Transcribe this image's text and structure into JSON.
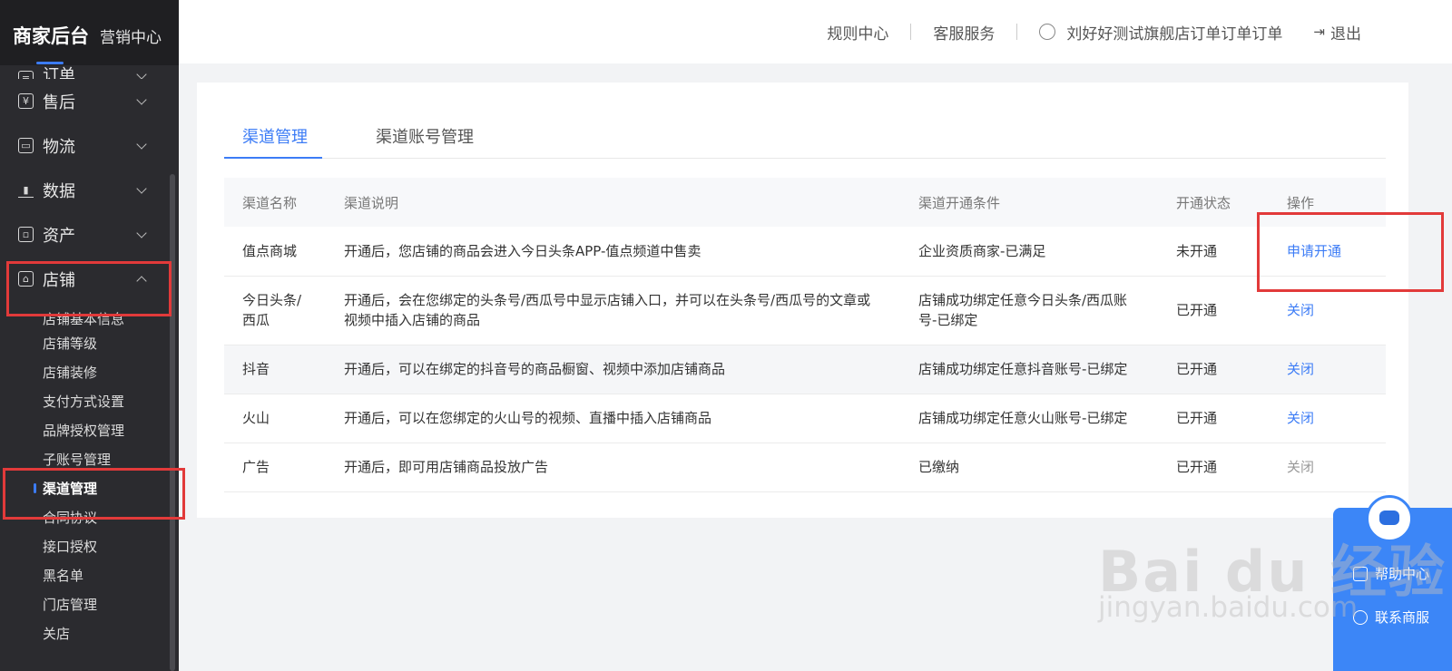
{
  "brand": {
    "title": "商家后台",
    "subtitle": "营销中心"
  },
  "sidebar": {
    "items": [
      {
        "label": "订单",
        "icon": "order-icon",
        "partial": true
      },
      {
        "label": "售后",
        "icon": "aftersale-icon"
      },
      {
        "label": "物流",
        "icon": "truck-icon"
      },
      {
        "label": "数据",
        "icon": "bar-chart-icon"
      },
      {
        "label": "资产",
        "icon": "asset-icon"
      },
      {
        "label": "店铺",
        "icon": "store-icon",
        "expanded": true
      }
    ],
    "store_sub": [
      "店铺基本信息",
      "店铺等级",
      "店铺装修",
      "支付方式设置",
      "品牌授权管理",
      "子账号管理",
      "渠道管理",
      "合同协议",
      "接口授权",
      "黑名单",
      "门店管理",
      "关店"
    ],
    "active_sub": "渠道管理"
  },
  "header": {
    "rules": "规则中心",
    "service": "客服服务",
    "user": "刘好好测试旗舰店订单订单订单",
    "logout": "退出"
  },
  "tabs": {
    "channel_mgmt": "渠道管理",
    "channel_account_mgmt": "渠道账号管理"
  },
  "table": {
    "headers": [
      "渠道名称",
      "渠道说明",
      "渠道开通条件",
      "开通状态",
      "操作"
    ],
    "rows": [
      {
        "name": "值点商城",
        "desc": "开通后，您店铺的商品会进入今日头条APP-值点频道中售卖",
        "cond": "企业资质商家-已满足",
        "status": "未开通",
        "action": "申请开通"
      },
      {
        "name": "今日头条/西瓜",
        "desc": "开通后，会在您绑定的头条号/西瓜号中显示店铺入口，并可以在头条号/西瓜号的文章或视频中插入店铺的商品",
        "cond": "店铺成功绑定任意今日头条/西瓜账号-已绑定",
        "status": "已开通",
        "action": "关闭"
      },
      {
        "name": "抖音",
        "desc": "开通后，可以在绑定的抖音号的商品橱窗、视频中添加店铺商品",
        "cond": "店铺成功绑定任意抖音账号-已绑定",
        "status": "已开通",
        "action": "关闭"
      },
      {
        "name": "火山",
        "desc": "开通后，可以在您绑定的火山号的视频、直播中插入店铺商品",
        "cond": "店铺成功绑定任意火山账号-已绑定",
        "status": "已开通",
        "action": "关闭"
      },
      {
        "name": "广告",
        "desc": "开通后，即可用店铺商品投放广告",
        "cond": "已缴纳",
        "status": "已开通",
        "action": "关闭"
      }
    ]
  },
  "help": {
    "help_center": "帮助中心",
    "contact": "联系商服"
  },
  "watermark": {
    "main": "Bai du 经验",
    "url": "jingyan.baidu.com"
  }
}
